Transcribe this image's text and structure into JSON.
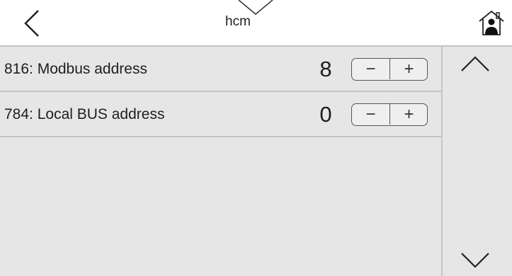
{
  "header": {
    "title": "hcm",
    "back_icon": "chevron-left-icon",
    "home_icon": "home-icon",
    "pulldown_icon": "chevron-down-icon"
  },
  "parameters": [
    {
      "label": "816: Modbus address",
      "value": "8",
      "decrement_label": "−",
      "increment_label": "+"
    },
    {
      "label": "784: Local BUS address",
      "value": "0",
      "decrement_label": "−",
      "increment_label": "+"
    }
  ],
  "scroll": {
    "up_icon": "chevron-up-icon",
    "down_icon": "chevron-down-icon"
  }
}
